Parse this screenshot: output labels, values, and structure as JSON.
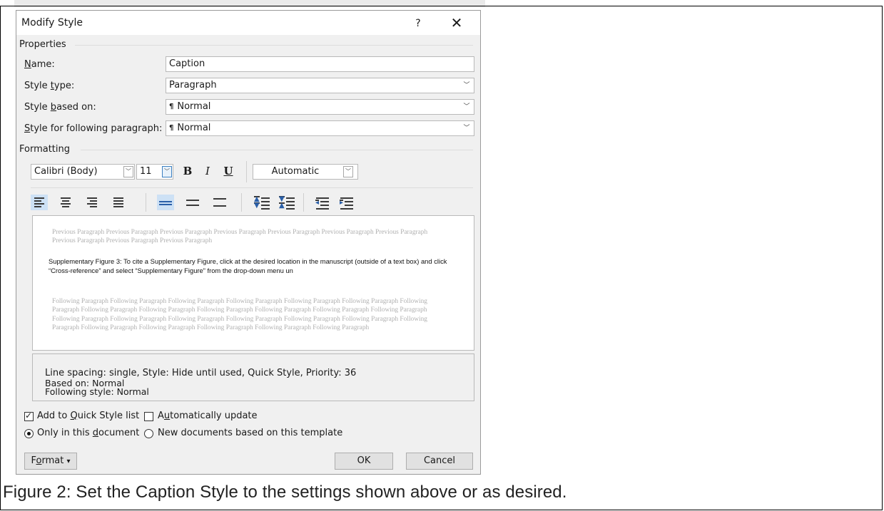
{
  "document": {
    "caption": "Figure 2: Set the Caption Style to the settings shown above or as desired."
  },
  "dialog": {
    "title": "Modify Style",
    "help_label": "?",
    "close_label": "✕",
    "properties_label": "Properties",
    "formatting_label": "Formatting",
    "fields": {
      "name": {
        "label_pre": "",
        "label_u": "N",
        "label_post": "ame:",
        "value": "Caption"
      },
      "style_type": {
        "label_pre": "Style ",
        "label_u": "t",
        "label_post": "ype:",
        "value": "Paragraph"
      },
      "based_on": {
        "label_pre": "Style ",
        "label_u": "b",
        "label_post": "ased on:",
        "value": "Normal"
      },
      "following": {
        "label_pre": "",
        "label_u": "S",
        "label_post": "tyle for following paragraph:",
        "value": "Normal"
      }
    },
    "formatting": {
      "font": "Calibri (Body)",
      "size": "11",
      "bold": "B",
      "italic": "I",
      "underline": "U",
      "color": "Automatic"
    },
    "preview": {
      "previous": "Previous Paragraph Previous Paragraph Previous Paragraph Previous Paragraph Previous Paragraph Previous Paragraph Previous Paragraph Previous Paragraph Previous Paragraph Previous Paragraph",
      "sample": "Supplementary Figure 3: To cite a Supplementary Figure, click at the desired location in the manuscript (outside of a text box) and click “Cross-reference” and select “Supplementary Figure” from the drop-down menu un",
      "following": "Following Paragraph Following Paragraph Following Paragraph Following Paragraph Following Paragraph Following Paragraph Following Paragraph Following Paragraph Following Paragraph Following Paragraph Following Paragraph Following Paragraph Following Paragraph Following Paragraph Following Paragraph Following Paragraph Following Paragraph Following Paragraph Following Paragraph Following Paragraph Following Paragraph Following Paragraph Following Paragraph Following Paragraph Following Paragraph"
    },
    "description": {
      "line1": "Line spacing:  single, Style: Hide until used, Quick Style, Priority: 36",
      "line2": "Based on: Normal",
      "line3": "Following style: Normal"
    },
    "options": {
      "add_quick_pre": "Add to ",
      "add_quick_u": "Q",
      "add_quick_post": "uick Style list",
      "add_quick_checked": true,
      "auto_update_pre": "A",
      "auto_update_u": "u",
      "auto_update_post": "tomatically update",
      "auto_update_checked": false,
      "only_doc_pre": "Only in this ",
      "only_doc_u": "d",
      "only_doc_post": "ocument",
      "only_doc_selected": true,
      "new_docs": "New documents based on this template",
      "new_docs_selected": false
    },
    "buttons": {
      "format_pre": "F",
      "format_u": "o",
      "format_post": "rmat",
      "format_arrow": "▾",
      "ok": "OK",
      "cancel": "Cancel"
    }
  }
}
